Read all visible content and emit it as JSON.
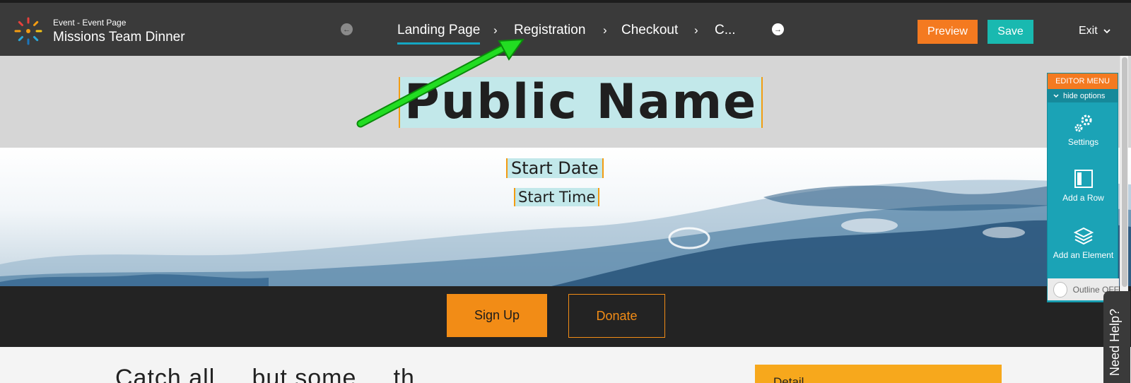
{
  "app": {
    "subtitle": "Event - Event Page",
    "title": "Missions Team Dinner"
  },
  "steps": [
    {
      "label": "Landing Page",
      "active": true
    },
    {
      "label": "Registration",
      "active": false
    },
    {
      "label": "Checkout",
      "active": false
    },
    {
      "label": "C...",
      "active": false
    }
  ],
  "separator": "›",
  "toolbar": {
    "preview_label": "Preview",
    "save_label": "Save",
    "exit_label": "Exit"
  },
  "hero": {
    "public_name": "Public Name",
    "start_date": "Start Date",
    "start_time": "Start Time"
  },
  "actions": {
    "signup_label": "Sign Up",
    "donate_label": "Donate"
  },
  "content": {
    "headline": "Catch all ... but some ... th",
    "detail_label": "Detail"
  },
  "editor_menu": {
    "title": "EDITOR MENU",
    "hide_label": "hide options",
    "items": [
      {
        "label": "Settings",
        "icon": "gears-icon"
      },
      {
        "label": "Add a Row",
        "icon": "row-icon"
      },
      {
        "label": "Add an Element",
        "icon": "layers-icon"
      }
    ],
    "outline_label": "Outline OFF"
  },
  "help": {
    "label": "Need Help?"
  },
  "colors": {
    "topbar": "#3a3a3a",
    "accent_orange": "#f47a20",
    "accent_teal": "#19b9b0",
    "highlight": "#c2e8ea",
    "annotation_arrow": "#22dd22"
  }
}
